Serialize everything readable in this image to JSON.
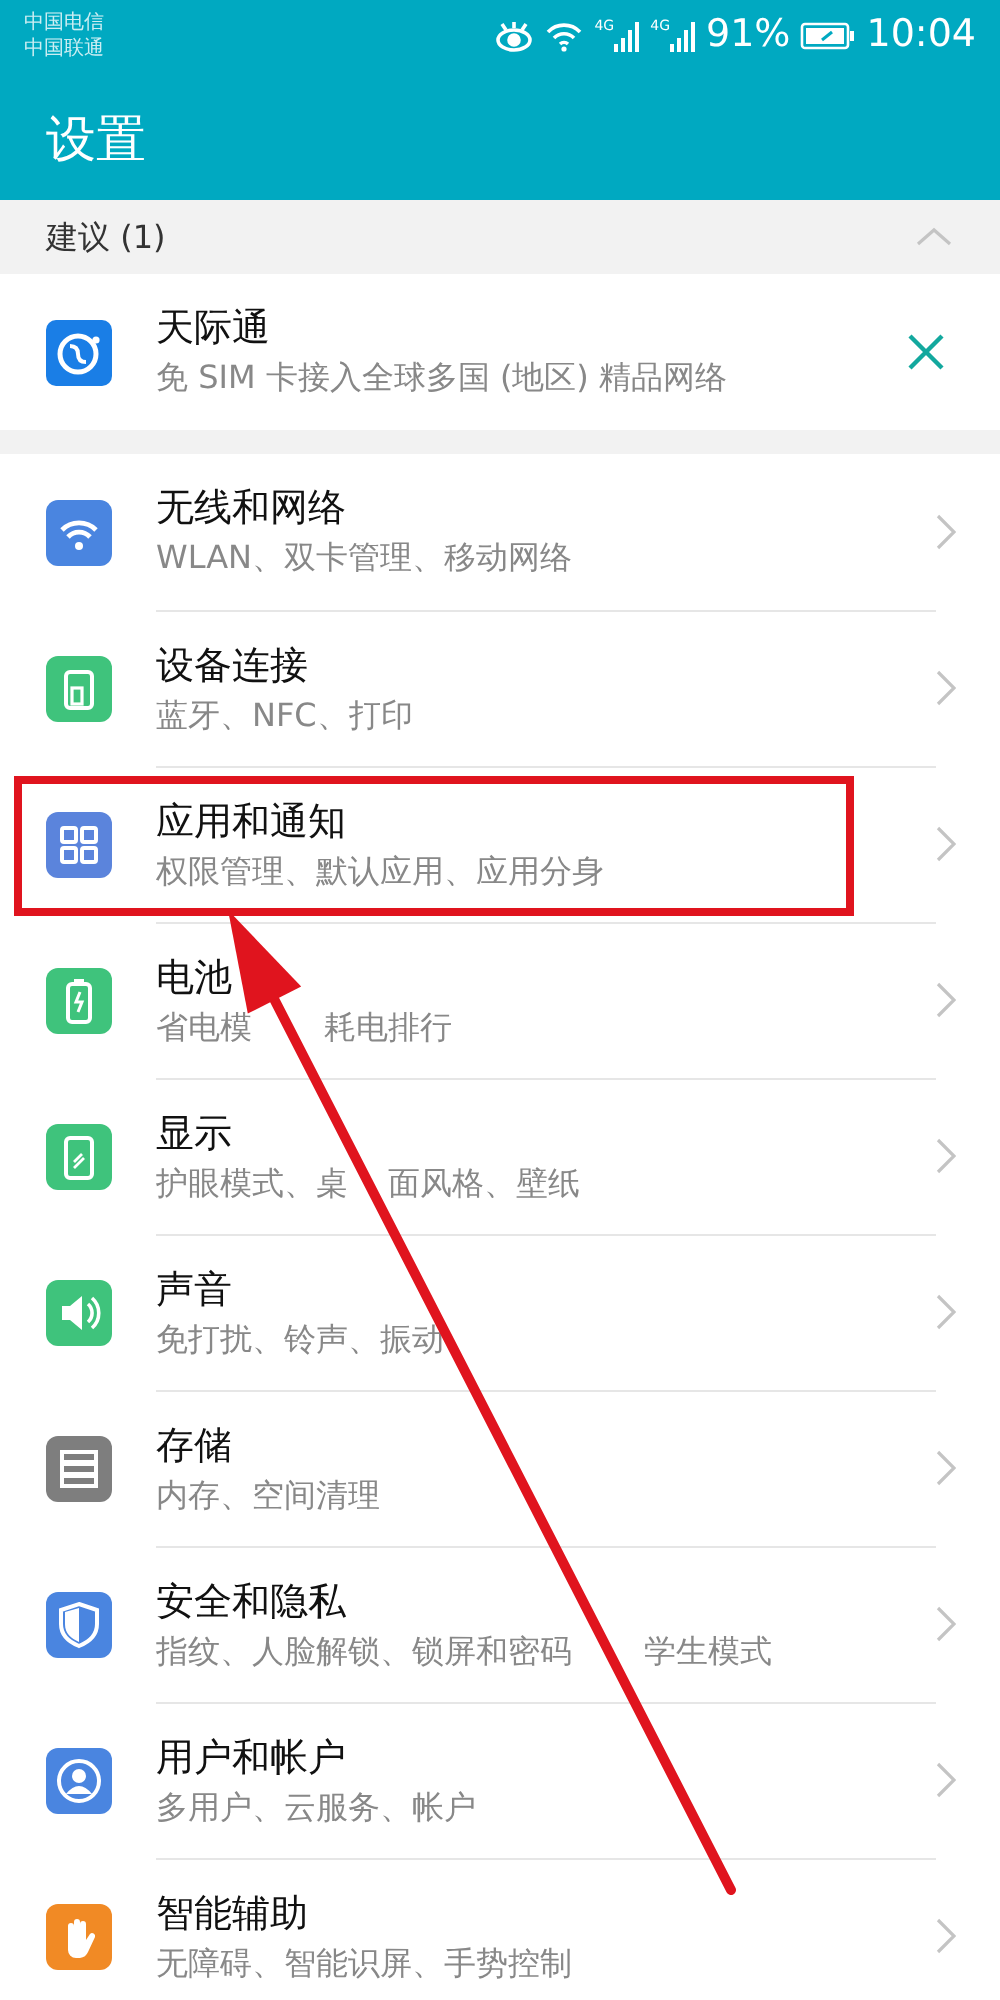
{
  "status_bar": {
    "carriers": [
      "中国电信",
      "中国联通"
    ],
    "network_1": "4G",
    "network_2": "4G",
    "battery": "91%",
    "time": "10:04"
  },
  "title": "设置",
  "suggestions": {
    "header": "建议 (1)",
    "expanded": true,
    "items": [
      {
        "title": "天际通",
        "subtitle": "免 SIM 卡接入全球多国 (地区) 精品网络"
      }
    ]
  },
  "items": [
    {
      "title": "无线和网络",
      "subtitle": "WLAN、双卡管理、移动网络",
      "highlighted": false
    },
    {
      "title": "设备连接",
      "subtitle": "蓝牙、NFC、打印",
      "highlighted": false
    },
    {
      "title": "应用和通知",
      "subtitle": "权限管理、默认应用、应用分身",
      "highlighted": true
    },
    {
      "title": "电池",
      "subtitle": [
        "省电模",
        "耗电排行"
      ],
      "highlighted": false
    },
    {
      "title": "显示",
      "subtitle": [
        "护眼模式、桌",
        "面风格、壁纸"
      ],
      "highlighted": false
    },
    {
      "title": "声音",
      "subtitle": "免打扰、铃声、振动",
      "highlighted": false
    },
    {
      "title": "存储",
      "subtitle": "内存、空间清理",
      "highlighted": false
    },
    {
      "title": "安全和隐私",
      "subtitle": [
        "指纹、人脸解锁、锁屏和密码",
        "学生模式"
      ],
      "highlighted": false
    },
    {
      "title": "用户和帐户",
      "subtitle": "多用户、云服务、帐户",
      "highlighted": false
    },
    {
      "title": "智能辅助",
      "subtitle": "无障碍、智能识屏、手势控制",
      "highlighted": false
    }
  ]
}
